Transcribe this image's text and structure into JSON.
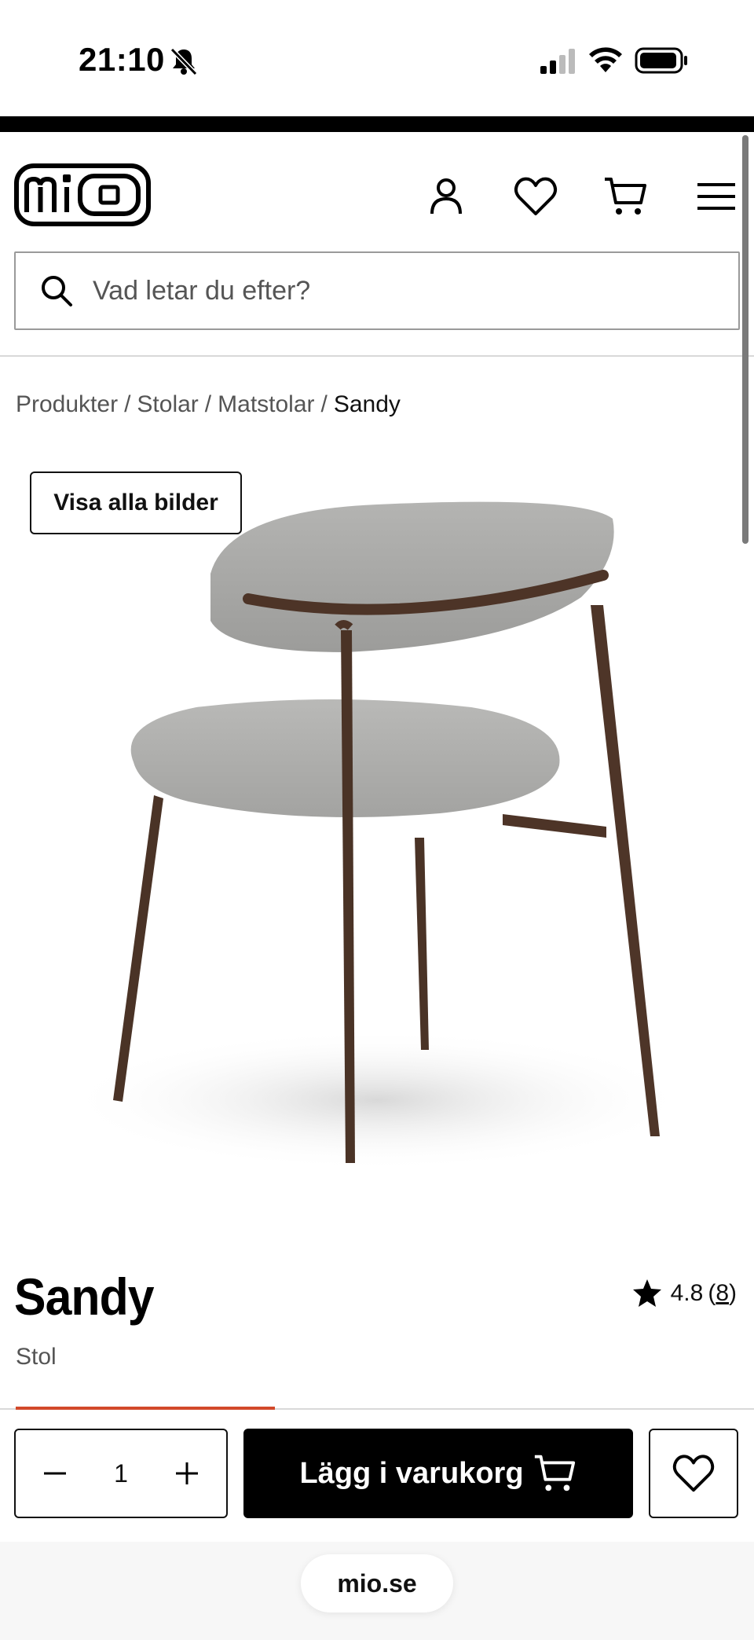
{
  "status_bar": {
    "time": "21:10"
  },
  "header": {
    "logo_text": "mio",
    "icons": [
      "account-icon",
      "heart-icon",
      "cart-icon",
      "menu-icon"
    ]
  },
  "search": {
    "placeholder": "Vad letar du efter?"
  },
  "breadcrumb": {
    "items": [
      "Produkter",
      "Stolar",
      "Matstolar"
    ],
    "current": "Sandy"
  },
  "gallery": {
    "view_all_label": "Visa alla bilder"
  },
  "product": {
    "title": "Sandy",
    "subtitle": "Stol",
    "rating": "4.8",
    "review_count": "8"
  },
  "actions": {
    "quantity": "1",
    "add_to_cart_label": "Lägg i varukorg"
  },
  "browser": {
    "domain": "mio.se"
  },
  "colors": {
    "accent": "#d2492a",
    "primary_button": "#000000"
  }
}
